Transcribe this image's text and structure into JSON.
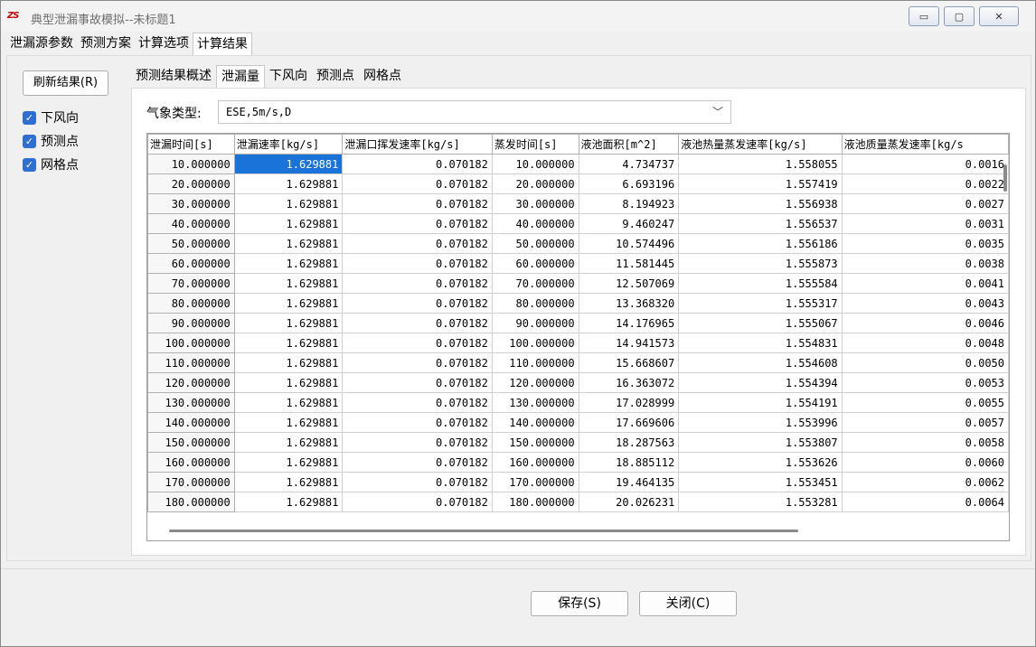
{
  "window": {
    "logo": "ZS",
    "title": "典型泄漏事故模拟--未标题1",
    "controls": {
      "minimize": "▭",
      "maximize": "▢",
      "close": "✕"
    }
  },
  "main_tabs": [
    {
      "label": "泄漏源参数"
    },
    {
      "label": "预测方案"
    },
    {
      "label": "计算选项"
    },
    {
      "label": "计算结果",
      "active": true
    }
  ],
  "left_panel": {
    "refresh_label": "刷新结果(R)",
    "checks": [
      {
        "label": "下风向",
        "checked": true
      },
      {
        "label": "预测点",
        "checked": true
      },
      {
        "label": "网格点",
        "checked": true
      }
    ]
  },
  "sub_tabs": [
    {
      "label": "预测结果概述"
    },
    {
      "label": "泄漏量",
      "active": true
    },
    {
      "label": "下风向"
    },
    {
      "label": "预测点"
    },
    {
      "label": "网格点"
    }
  ],
  "weather": {
    "label": "气象类型:",
    "value": "ESE,5m/s,D"
  },
  "table": {
    "columns": [
      "泄漏时间[s]",
      "泄漏速率[kg/s]",
      "泄漏口挥发速率[kg/s]",
      "蒸发时间[s]",
      "液池面积[m^2]",
      "液池热量蒸发速率[kg/s]",
      "液池质量蒸发速率[kg/s"
    ],
    "rows": [
      [
        "10.000000",
        "1.629881",
        "0.070182",
        "10.000000",
        "4.734737",
        "1.558055",
        "0.0016"
      ],
      [
        "20.000000",
        "1.629881",
        "0.070182",
        "20.000000",
        "6.693196",
        "1.557419",
        "0.0022"
      ],
      [
        "30.000000",
        "1.629881",
        "0.070182",
        "30.000000",
        "8.194923",
        "1.556938",
        "0.0027"
      ],
      [
        "40.000000",
        "1.629881",
        "0.070182",
        "40.000000",
        "9.460247",
        "1.556537",
        "0.0031"
      ],
      [
        "50.000000",
        "1.629881",
        "0.070182",
        "50.000000",
        "10.574496",
        "1.556186",
        "0.0035"
      ],
      [
        "60.000000",
        "1.629881",
        "0.070182",
        "60.000000",
        "11.581445",
        "1.555873",
        "0.0038"
      ],
      [
        "70.000000",
        "1.629881",
        "0.070182",
        "70.000000",
        "12.507069",
        "1.555584",
        "0.0041"
      ],
      [
        "80.000000",
        "1.629881",
        "0.070182",
        "80.000000",
        "13.368320",
        "1.555317",
        "0.0043"
      ],
      [
        "90.000000",
        "1.629881",
        "0.070182",
        "90.000000",
        "14.176965",
        "1.555067",
        "0.0046"
      ],
      [
        "100.000000",
        "1.629881",
        "0.070182",
        "100.000000",
        "14.941573",
        "1.554831",
        "0.0048"
      ],
      [
        "110.000000",
        "1.629881",
        "0.070182",
        "110.000000",
        "15.668607",
        "1.554608",
        "0.0050"
      ],
      [
        "120.000000",
        "1.629881",
        "0.070182",
        "120.000000",
        "16.363072",
        "1.554394",
        "0.0053"
      ],
      [
        "130.000000",
        "1.629881",
        "0.070182",
        "130.000000",
        "17.028999",
        "1.554191",
        "0.0055"
      ],
      [
        "140.000000",
        "1.629881",
        "0.070182",
        "140.000000",
        "17.669606",
        "1.553996",
        "0.0057"
      ],
      [
        "150.000000",
        "1.629881",
        "0.070182",
        "150.000000",
        "18.287563",
        "1.553807",
        "0.0058"
      ],
      [
        "160.000000",
        "1.629881",
        "0.070182",
        "160.000000",
        "18.885112",
        "1.553626",
        "0.0060"
      ],
      [
        "170.000000",
        "1.629881",
        "0.070182",
        "170.000000",
        "19.464135",
        "1.553451",
        "0.0062"
      ],
      [
        "180.000000",
        "1.629881",
        "0.070182",
        "180.000000",
        "20.026231",
        "1.553281",
        "0.0064"
      ]
    ],
    "selected": {
      "row": 0,
      "col": 1
    }
  },
  "footer": {
    "save_label": "保存(S)",
    "close_label": "关闭(C)"
  },
  "colors": {
    "selection": "#1a73d9",
    "checkbox": "#2f6fd4",
    "title_text": "#6e6e6e"
  }
}
